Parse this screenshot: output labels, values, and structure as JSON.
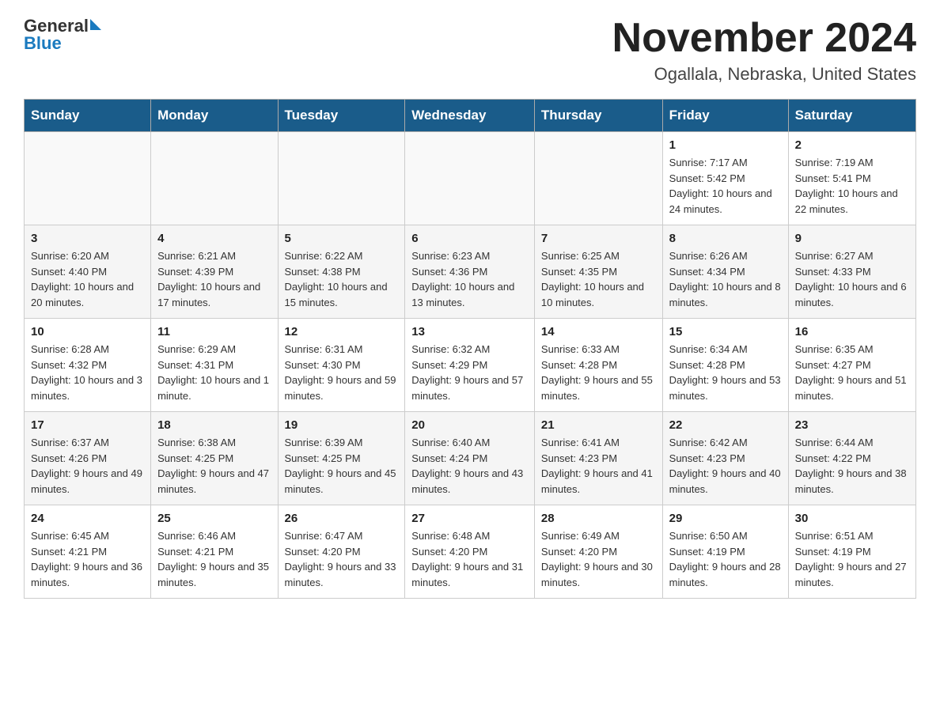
{
  "header": {
    "logo_text_general": "General",
    "logo_text_blue": "Blue",
    "month_title": "November 2024",
    "location": "Ogallala, Nebraska, United States"
  },
  "weekdays": [
    "Sunday",
    "Monday",
    "Tuesday",
    "Wednesday",
    "Thursday",
    "Friday",
    "Saturday"
  ],
  "weeks": [
    {
      "days": [
        {
          "num": "",
          "info": ""
        },
        {
          "num": "",
          "info": ""
        },
        {
          "num": "",
          "info": ""
        },
        {
          "num": "",
          "info": ""
        },
        {
          "num": "",
          "info": ""
        },
        {
          "num": "1",
          "info": "Sunrise: 7:17 AM\nSunset: 5:42 PM\nDaylight: 10 hours and 24 minutes."
        },
        {
          "num": "2",
          "info": "Sunrise: 7:19 AM\nSunset: 5:41 PM\nDaylight: 10 hours and 22 minutes."
        }
      ]
    },
    {
      "days": [
        {
          "num": "3",
          "info": "Sunrise: 6:20 AM\nSunset: 4:40 PM\nDaylight: 10 hours and 20 minutes."
        },
        {
          "num": "4",
          "info": "Sunrise: 6:21 AM\nSunset: 4:39 PM\nDaylight: 10 hours and 17 minutes."
        },
        {
          "num": "5",
          "info": "Sunrise: 6:22 AM\nSunset: 4:38 PM\nDaylight: 10 hours and 15 minutes."
        },
        {
          "num": "6",
          "info": "Sunrise: 6:23 AM\nSunset: 4:36 PM\nDaylight: 10 hours and 13 minutes."
        },
        {
          "num": "7",
          "info": "Sunrise: 6:25 AM\nSunset: 4:35 PM\nDaylight: 10 hours and 10 minutes."
        },
        {
          "num": "8",
          "info": "Sunrise: 6:26 AM\nSunset: 4:34 PM\nDaylight: 10 hours and 8 minutes."
        },
        {
          "num": "9",
          "info": "Sunrise: 6:27 AM\nSunset: 4:33 PM\nDaylight: 10 hours and 6 minutes."
        }
      ]
    },
    {
      "days": [
        {
          "num": "10",
          "info": "Sunrise: 6:28 AM\nSunset: 4:32 PM\nDaylight: 10 hours and 3 minutes."
        },
        {
          "num": "11",
          "info": "Sunrise: 6:29 AM\nSunset: 4:31 PM\nDaylight: 10 hours and 1 minute."
        },
        {
          "num": "12",
          "info": "Sunrise: 6:31 AM\nSunset: 4:30 PM\nDaylight: 9 hours and 59 minutes."
        },
        {
          "num": "13",
          "info": "Sunrise: 6:32 AM\nSunset: 4:29 PM\nDaylight: 9 hours and 57 minutes."
        },
        {
          "num": "14",
          "info": "Sunrise: 6:33 AM\nSunset: 4:28 PM\nDaylight: 9 hours and 55 minutes."
        },
        {
          "num": "15",
          "info": "Sunrise: 6:34 AM\nSunset: 4:28 PM\nDaylight: 9 hours and 53 minutes."
        },
        {
          "num": "16",
          "info": "Sunrise: 6:35 AM\nSunset: 4:27 PM\nDaylight: 9 hours and 51 minutes."
        }
      ]
    },
    {
      "days": [
        {
          "num": "17",
          "info": "Sunrise: 6:37 AM\nSunset: 4:26 PM\nDaylight: 9 hours and 49 minutes."
        },
        {
          "num": "18",
          "info": "Sunrise: 6:38 AM\nSunset: 4:25 PM\nDaylight: 9 hours and 47 minutes."
        },
        {
          "num": "19",
          "info": "Sunrise: 6:39 AM\nSunset: 4:25 PM\nDaylight: 9 hours and 45 minutes."
        },
        {
          "num": "20",
          "info": "Sunrise: 6:40 AM\nSunset: 4:24 PM\nDaylight: 9 hours and 43 minutes."
        },
        {
          "num": "21",
          "info": "Sunrise: 6:41 AM\nSunset: 4:23 PM\nDaylight: 9 hours and 41 minutes."
        },
        {
          "num": "22",
          "info": "Sunrise: 6:42 AM\nSunset: 4:23 PM\nDaylight: 9 hours and 40 minutes."
        },
        {
          "num": "23",
          "info": "Sunrise: 6:44 AM\nSunset: 4:22 PM\nDaylight: 9 hours and 38 minutes."
        }
      ]
    },
    {
      "days": [
        {
          "num": "24",
          "info": "Sunrise: 6:45 AM\nSunset: 4:21 PM\nDaylight: 9 hours and 36 minutes."
        },
        {
          "num": "25",
          "info": "Sunrise: 6:46 AM\nSunset: 4:21 PM\nDaylight: 9 hours and 35 minutes."
        },
        {
          "num": "26",
          "info": "Sunrise: 6:47 AM\nSunset: 4:20 PM\nDaylight: 9 hours and 33 minutes."
        },
        {
          "num": "27",
          "info": "Sunrise: 6:48 AM\nSunset: 4:20 PM\nDaylight: 9 hours and 31 minutes."
        },
        {
          "num": "28",
          "info": "Sunrise: 6:49 AM\nSunset: 4:20 PM\nDaylight: 9 hours and 30 minutes."
        },
        {
          "num": "29",
          "info": "Sunrise: 6:50 AM\nSunset: 4:19 PM\nDaylight: 9 hours and 28 minutes."
        },
        {
          "num": "30",
          "info": "Sunrise: 6:51 AM\nSunset: 4:19 PM\nDaylight: 9 hours and 27 minutes."
        }
      ]
    }
  ]
}
